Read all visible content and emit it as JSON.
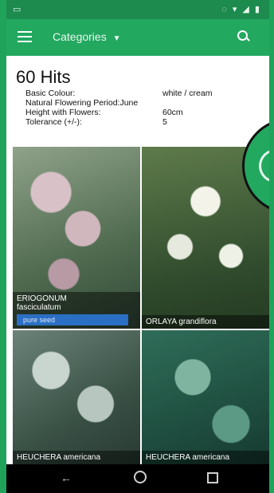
{
  "app": {
    "categories_label": "Categories"
  },
  "header": {
    "hits": "60 Hits"
  },
  "specs": [
    {
      "key": "Basic Colour:",
      "value": "white / cream"
    },
    {
      "key": "Natural Flowering Period:",
      "value": "June"
    },
    {
      "key": "Height with Flowers:",
      "value": "60cm"
    },
    {
      "key": "Tolerance (+/-):",
      "value": "5"
    }
  ],
  "results": [
    {
      "genus": "ERIOGONUM",
      "species": "fasciculatum",
      "badge": "pure seed"
    },
    {
      "genus": "ORLAYA",
      "species": "grandiflora",
      "badge": ""
    },
    {
      "genus": "HEUCHERA",
      "species": "americana",
      "badge": ""
    },
    {
      "genus": "HEUCHERA",
      "species": "americana",
      "badge": ""
    }
  ],
  "colors": {
    "app_bar": "#23a860",
    "status_bar": "#1d8a4e",
    "badge": "#2a6fc4"
  },
  "icons": {
    "menu": "hamburger-icon",
    "dropdown": "chevron-down-icon",
    "search": "search-icon",
    "back": "back-icon",
    "home": "home-icon",
    "recent": "recent-apps-icon"
  }
}
